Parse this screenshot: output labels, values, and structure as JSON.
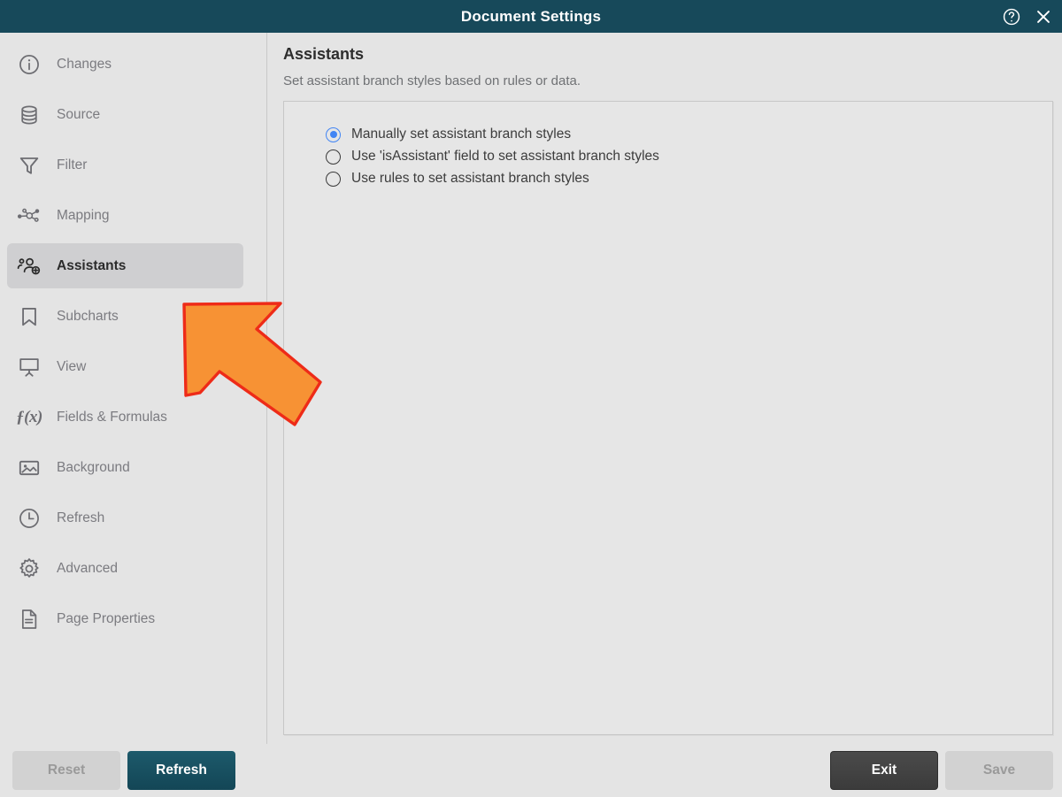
{
  "titlebar": {
    "title": "Document Settings",
    "help_icon": "help-circle-icon",
    "close_icon": "close-icon",
    "background_color": "#17495a"
  },
  "sidebar": {
    "items": [
      {
        "label": "Changes",
        "icon": "info-circle-icon",
        "selected": false
      },
      {
        "label": "Source",
        "icon": "database-icon",
        "selected": false
      },
      {
        "label": "Filter",
        "icon": "funnel-icon",
        "selected": false
      },
      {
        "label": "Mapping",
        "icon": "node-graph-icon",
        "selected": false
      },
      {
        "label": "Assistants",
        "icon": "people-add-icon",
        "selected": true
      },
      {
        "label": "Subcharts",
        "icon": "bookmark-icon",
        "selected": false
      },
      {
        "label": "View",
        "icon": "presentation-icon",
        "selected": false
      },
      {
        "label": "Fields & Formulas",
        "icon": "function-fx-icon",
        "selected": false
      },
      {
        "label": "Background",
        "icon": "image-icon",
        "selected": false
      },
      {
        "label": "Refresh",
        "icon": "clock-icon",
        "selected": false
      },
      {
        "label": "Advanced",
        "icon": "gear-icon",
        "selected": false
      },
      {
        "label": "Page Properties",
        "icon": "document-icon",
        "selected": false
      }
    ]
  },
  "content": {
    "title": "Assistants",
    "subtitle": "Set assistant branch styles based on rules or data.",
    "radio_options": [
      {
        "label": "Manually set assistant branch styles",
        "checked": true
      },
      {
        "label": "Use 'isAssistant' field to set assistant branch styles",
        "checked": false
      },
      {
        "label": "Use rules to set assistant branch styles",
        "checked": false
      }
    ]
  },
  "footer": {
    "reset_label": "Reset",
    "reset_enabled": false,
    "refresh_label": "Refresh",
    "refresh_enabled": true,
    "exit_label": "Exit",
    "exit_enabled": true,
    "save_label": "Save",
    "save_enabled": false,
    "accent_color": "#17495a"
  },
  "annotation": {
    "arrow": "pointer-arrow-annotation",
    "fill_color": "#f79234",
    "stroke_color": "#ee2b18"
  }
}
